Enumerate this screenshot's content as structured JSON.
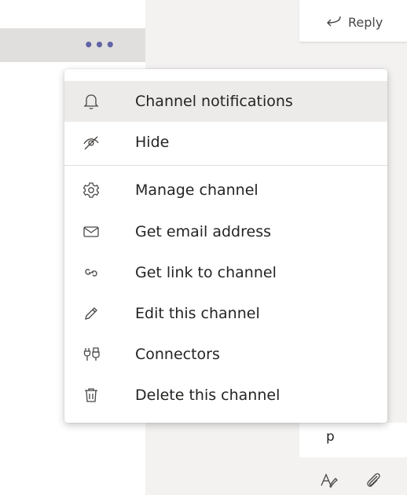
{
  "channel_list": {
    "more_options_icon": "ellipsis-icon"
  },
  "conversation": {
    "reply_label": "Reply",
    "compose_text": "p"
  },
  "menu": {
    "items": [
      {
        "label": "Channel notifications",
        "icon": "bell-icon"
      },
      {
        "label": "Hide",
        "icon": "eye-off-icon"
      },
      {
        "label": "Manage channel",
        "icon": "gear-icon"
      },
      {
        "label": "Get email address",
        "icon": "mail-icon"
      },
      {
        "label": "Get link to channel",
        "icon": "link-icon"
      },
      {
        "label": "Edit this channel",
        "icon": "pencil-icon"
      },
      {
        "label": "Connectors",
        "icon": "connectors-icon"
      },
      {
        "label": "Delete this channel",
        "icon": "trash-icon"
      }
    ]
  },
  "colors": {
    "accent": "#6264a7",
    "hover": "#edebe9",
    "panel": "#f3f2f1"
  }
}
